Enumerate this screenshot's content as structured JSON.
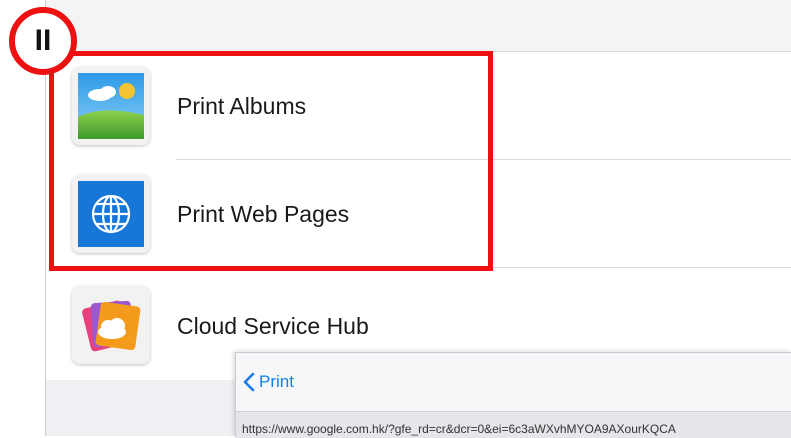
{
  "annotation": {
    "badge_label": "II",
    "color": "#ee1111"
  },
  "menu": {
    "items": [
      {
        "label": "Print Albums",
        "icon": "albums-icon"
      },
      {
        "label": "Print Web Pages",
        "icon": "globe-icon"
      },
      {
        "label": "Cloud Service Hub",
        "icon": "cloud-icon"
      }
    ]
  },
  "subpanel": {
    "back_label": "Print",
    "url": "https://www.google.com.hk/?gfe_rd=cr&dcr=0&ei=6c3aWXvhMYOA9AXourKQCA"
  },
  "colors": {
    "accent": "#1a7bf0",
    "background": "#ffffff",
    "separator": "#d9d9dd"
  }
}
